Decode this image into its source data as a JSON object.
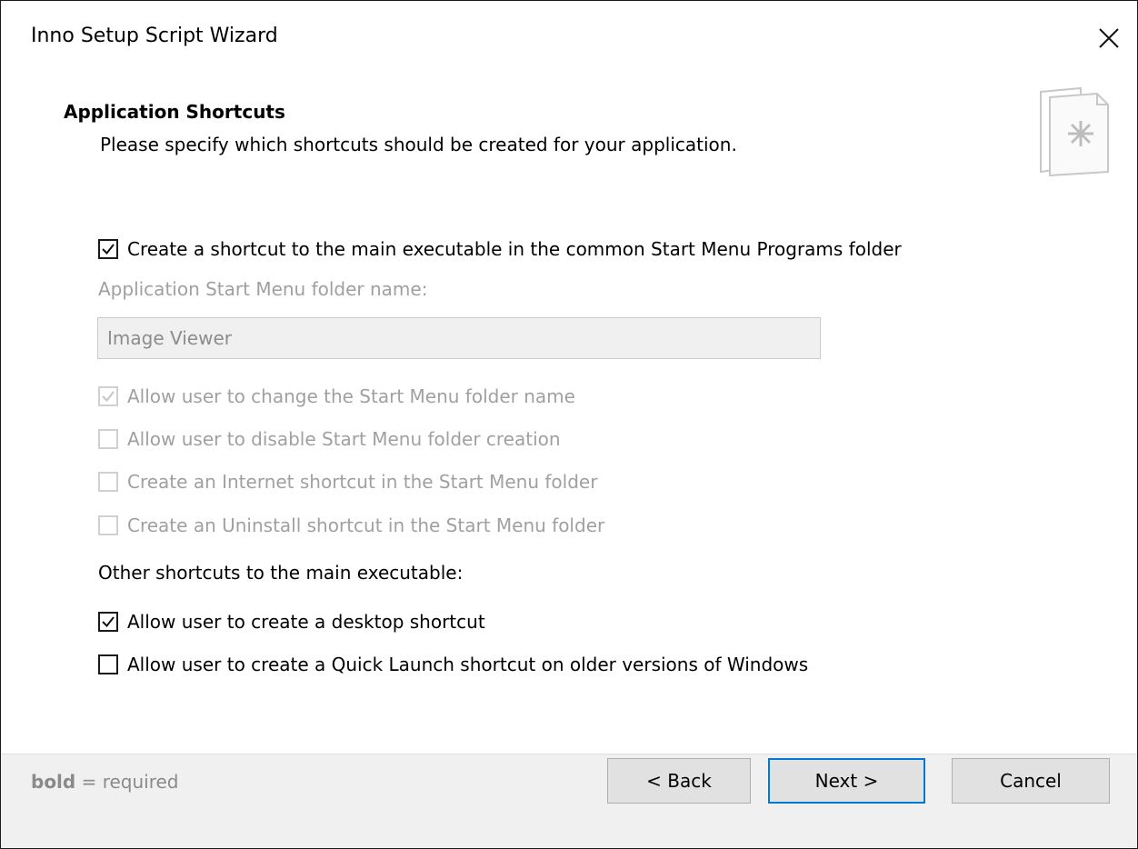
{
  "window": {
    "title": "Inno Setup Script Wizard"
  },
  "header": {
    "title": "Application Shortcuts",
    "subtitle": "Please specify which shortcuts should be created for your application."
  },
  "start_menu": {
    "create_shortcut": {
      "label": "Create a shortcut to the main executable in the common Start Menu Programs folder",
      "checked": true,
      "enabled": true
    },
    "folder_label": "Application Start Menu folder name:",
    "folder_value": "Image Viewer",
    "options": [
      {
        "label": "Allow user to change the Start Menu folder name",
        "checked": true,
        "enabled": false
      },
      {
        "label": "Allow user to disable Start Menu folder creation",
        "checked": false,
        "enabled": false
      },
      {
        "label": "Create an Internet shortcut in the Start Menu folder",
        "checked": false,
        "enabled": false
      },
      {
        "label": "Create an Uninstall shortcut in the Start Menu folder",
        "checked": false,
        "enabled": false
      }
    ]
  },
  "other_shortcuts": {
    "heading": "Other shortcuts to the main executable:",
    "options": [
      {
        "label": "Allow user to create a desktop shortcut",
        "checked": true,
        "enabled": true
      },
      {
        "label": "Allow user to create a Quick Launch shortcut on older versions of Windows",
        "checked": false,
        "enabled": true
      }
    ]
  },
  "footer": {
    "note_bold": "bold",
    "note_rest": " = required",
    "back_label": "< Back",
    "next_label": "Next >",
    "cancel_label": "Cancel"
  },
  "colors": {
    "accent": "#0078d7",
    "footer_bg": "#f0f0f0",
    "disabled_text": "#a0a0a0"
  },
  "icons": {
    "close": "close-icon",
    "wizard": "wizard-document-icon",
    "check": "check-icon"
  }
}
